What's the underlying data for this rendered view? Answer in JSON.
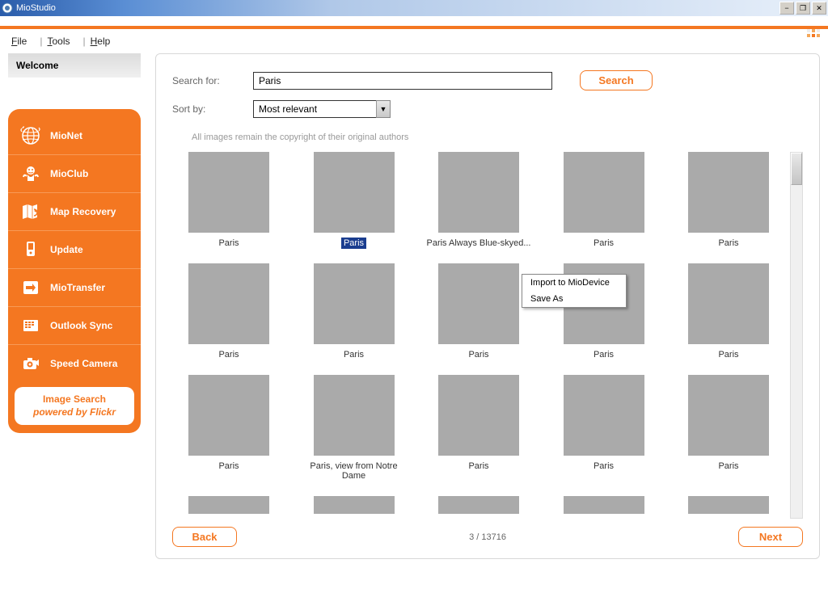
{
  "window": {
    "title": "MioStudio"
  },
  "menubar": {
    "file": "File",
    "tools": "Tools",
    "help": "Help"
  },
  "sidebar": {
    "welcome": "Welcome",
    "items": [
      {
        "label": "MioNet"
      },
      {
        "label": "MioClub"
      },
      {
        "label": "Map Recovery"
      },
      {
        "label": "Update"
      },
      {
        "label": "MioTransfer"
      },
      {
        "label": "Outlook Sync"
      },
      {
        "label": "Speed Camera"
      }
    ],
    "active": {
      "line1": "Image Search",
      "line2": "powered by Flickr"
    }
  },
  "search": {
    "label": "Search for:",
    "value": "Paris",
    "button": "Search",
    "sort_label": "Sort by:",
    "sort_value": "Most relevant",
    "copyright": "All images remain the copyright of their original authors"
  },
  "context_menu": {
    "import": "Import to MioDevice",
    "save": "Save As"
  },
  "results": [
    {
      "caption": "Paris"
    },
    {
      "caption": "Paris",
      "selected": true
    },
    {
      "caption": "Paris Always Blue-skyed..."
    },
    {
      "caption": "Paris"
    },
    {
      "caption": "Paris"
    },
    {
      "caption": "Paris"
    },
    {
      "caption": "Paris"
    },
    {
      "caption": "Paris"
    },
    {
      "caption": "Paris"
    },
    {
      "caption": "Paris"
    },
    {
      "caption": "Paris"
    },
    {
      "caption": "Paris, view from Notre Dame"
    },
    {
      "caption": "Paris"
    },
    {
      "caption": "Paris"
    },
    {
      "caption": "Paris"
    }
  ],
  "footer": {
    "back": "Back",
    "next": "Next",
    "pager": "3 / 13716"
  }
}
